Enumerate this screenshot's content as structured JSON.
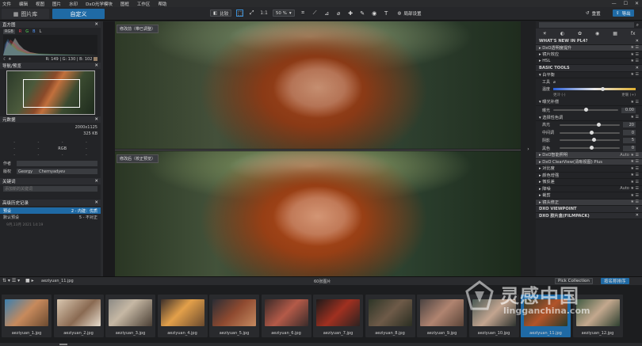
{
  "menu": [
    "文件",
    "编辑",
    "视图",
    "图片",
    "水印",
    "DxO光学模块",
    "图框",
    "工作区",
    "帮助"
  ],
  "window_controls": [
    "—",
    "☐",
    "✕"
  ],
  "tabs": {
    "library": "图片库",
    "customize": "自定义"
  },
  "toolbar": {
    "compare": "比较",
    "zoom_one": "1:1",
    "zoom_value": "50 %",
    "local_adjust": "局部设置",
    "reset": "重置",
    "export": "导出"
  },
  "left": {
    "histogram_title": "直方图",
    "rgb_readout": "R: 149 | G: 130 | B: 102",
    "channels": [
      "RGB",
      "R",
      "G",
      "B",
      "L"
    ],
    "nav_title": "导航/预览",
    "meta_title": "元数据",
    "meta_dims": "2000x1125",
    "meta_size": "325 KB",
    "meta_rgb": "RGB",
    "author_label": "作者",
    "copyright_label": "版权",
    "copyright_vals": [
      "Georgy",
      "Chernyadyev"
    ],
    "keywords_title": "关键词",
    "keywords_placeholder": "添加新的关键词",
    "history_title": "高级历史记录",
    "history_items": [
      {
        "name": "预设",
        "value": "2 - 内建：优质"
      },
      {
        "name": "默认预设",
        "value": "5 - 不对正"
      }
    ],
    "history_date": "9月,13月 2021 14:19"
  },
  "center": {
    "top_label": "修改前（带已调整）",
    "bottom_label": "修改后（校正预览）"
  },
  "right": {
    "icons": [
      "☀",
      "◐",
      "✿",
      "◉",
      "▦",
      "fx"
    ],
    "whats_new": "WHAT'S NEW IN PL4?",
    "wn_items": [
      "DxO透明度提升",
      "镜片效应",
      "HSL"
    ],
    "basic_tools": "BASIC TOOLS",
    "wb": "白平衡",
    "tool_label": "工具",
    "temp_label": "温度",
    "temp_left": "更冷 (-)",
    "temp_right": "更暖 (+)",
    "exposure": "曝光补偿",
    "exposure_label": "曝光",
    "exposure_val": "0.00",
    "tone": "选择性色调",
    "tone_rows": [
      {
        "label": "高光",
        "val": "20"
      },
      {
        "label": "中间调",
        "val": "0"
      },
      {
        "label": "阴影",
        "val": "5"
      },
      {
        "label": "黑色",
        "val": "0"
      }
    ],
    "smart_light": "DxO智能照明",
    "smart_val": "Auto",
    "clearview": "DxO ClearView(清晰视图) Plus",
    "contrast": "对比度",
    "color_acc": "颜色增强",
    "vibrancy": "微反差",
    "denoise": "降噪",
    "denoise_val": "Auto",
    "crop": "裁剪",
    "lens": "镜头修正",
    "viewpoint": "DXO VIEWPOINT",
    "filmpack": "DXO 胶片盒(FILMPACK)"
  },
  "filmbar": {
    "folder": "aeziyuan_11.jpg",
    "count": "60张图片",
    "apply": "Pick Collection",
    "sort_btn": "按名称排序"
  },
  "thumbs": [
    "aeziyuan_1.jpg",
    "aeziyuan_2.jpg",
    "aeziyuan_3.jpg",
    "aeziyuan_4.jpg",
    "aeziyuan_5.jpg",
    "aeziyuan_6.jpg",
    "aeziyuan_7.jpg",
    "aeziyuan_8.jpg",
    "aeziyuan_9.jpg",
    "aeziyuan_10.jpg",
    "aeziyuan_11.jpg",
    "aeziyuan_12.jpg"
  ],
  "watermark": {
    "brand": "灵感中国",
    "url": "lingganchina.com"
  },
  "colors": {
    "accent": "#1f6aa5",
    "panel": "#232427"
  }
}
